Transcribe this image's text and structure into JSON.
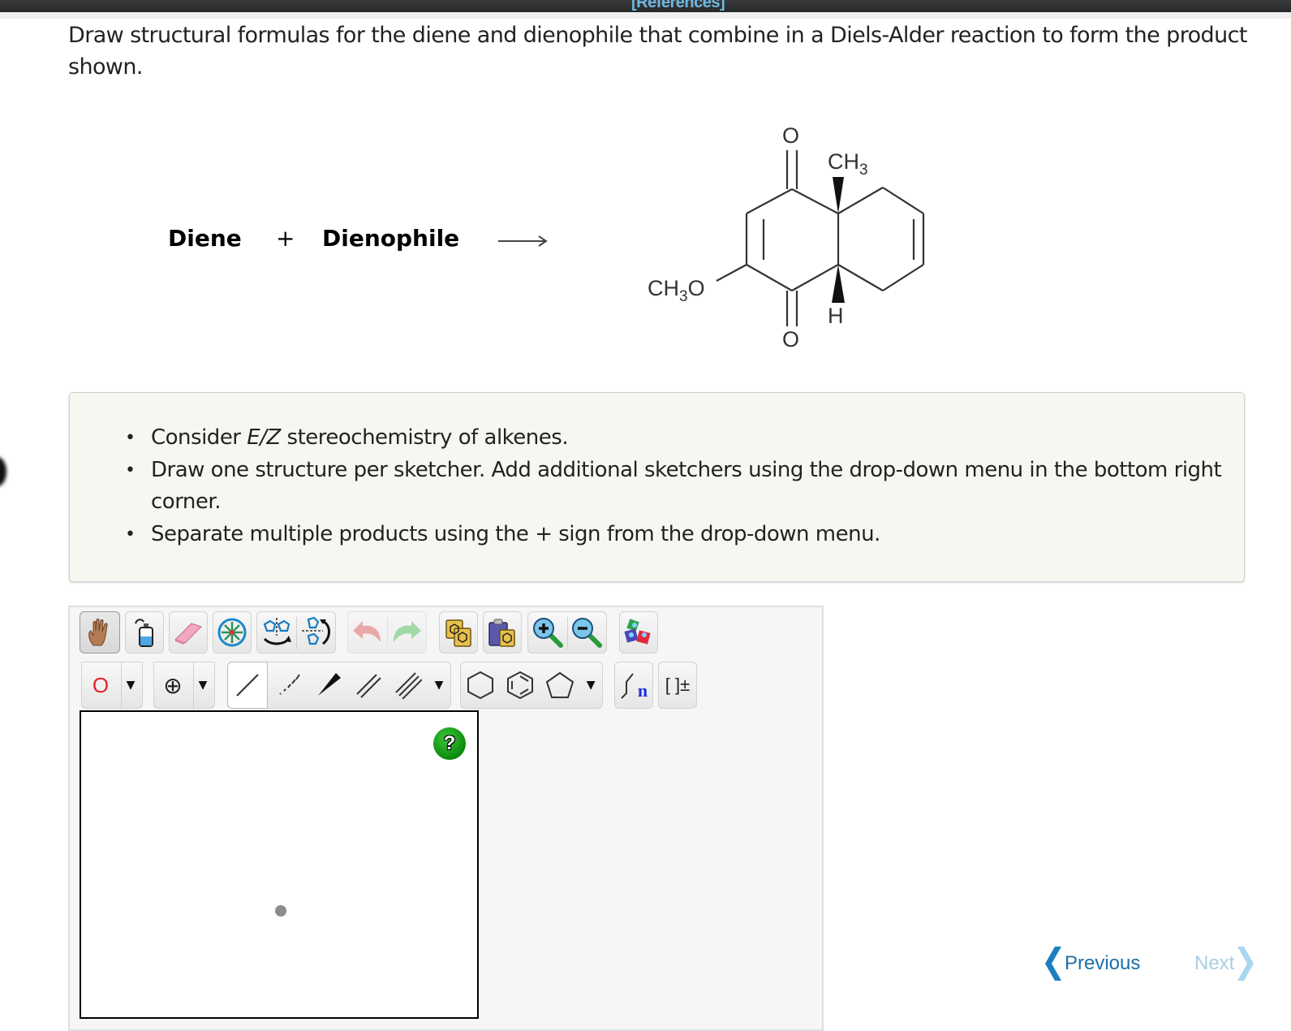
{
  "header": {
    "references_link": "[References]"
  },
  "question": {
    "text": "Draw structural formulas for the diene and dienophile that combine in a Diels-Alder reaction to form the product shown."
  },
  "reaction": {
    "reactant1": "Diene",
    "plus": "+",
    "reactant2": "Dienophile",
    "arrow": "→",
    "product": {
      "labels": {
        "top_oxygen": "O",
        "bottom_oxygen": "O",
        "methyl": "CH",
        "methyl_sub": "3",
        "methoxy_pre": "CH",
        "methoxy_sub": "3",
        "methoxy_post": "O",
        "hydrogen": "H"
      }
    }
  },
  "hints": [
    {
      "pre": "Consider ",
      "italic": "E/Z",
      "post": " stereochemistry of alkenes."
    },
    {
      "pre": "Draw one structure per sketcher. Add additional sketchers using the drop-down menu in the bottom right corner.",
      "italic": "",
      "post": ""
    },
    {
      "pre": "Separate multiple products using the + sign from the drop-down menu.",
      "italic": "",
      "post": ""
    }
  ],
  "sketcher": {
    "toolbar_top": [
      {
        "name": "move-tool",
        "icon": "hand-icon",
        "selected": true
      },
      {
        "name": "erase-all",
        "icon": "wash-bottle-icon"
      },
      {
        "name": "eraser",
        "icon": "eraser-icon"
      },
      {
        "name": "center",
        "icon": "center-icon"
      },
      {
        "name": "flip-horizontal",
        "icon": "flip-horizontal-icon"
      },
      {
        "name": "flip-vertical",
        "icon": "flip-vertical-icon"
      },
      {
        "name": "undo",
        "icon": "undo-icon"
      },
      {
        "name": "redo",
        "icon": "redo-icon"
      },
      {
        "name": "copy",
        "icon": "copy-icon"
      },
      {
        "name": "paste",
        "icon": "paste-icon"
      },
      {
        "name": "zoom-in",
        "icon": "zoom-in-icon"
      },
      {
        "name": "zoom-out",
        "icon": "zoom-out-icon"
      },
      {
        "name": "clean",
        "icon": "clean-structure-icon"
      }
    ],
    "atom_selector": "O",
    "charge_selector": "⊕",
    "ring_label": "n",
    "bracket_label": "[ ]±",
    "help_label": "?",
    "colors": {
      "atom": "#e8232a",
      "help_green": "#0c8a0c",
      "nav_active": "#1d6fa8",
      "nav_disabled": "#a9cde4"
    }
  },
  "navigation": {
    "previous": "Previous",
    "next": "Next",
    "next_enabled": false
  }
}
